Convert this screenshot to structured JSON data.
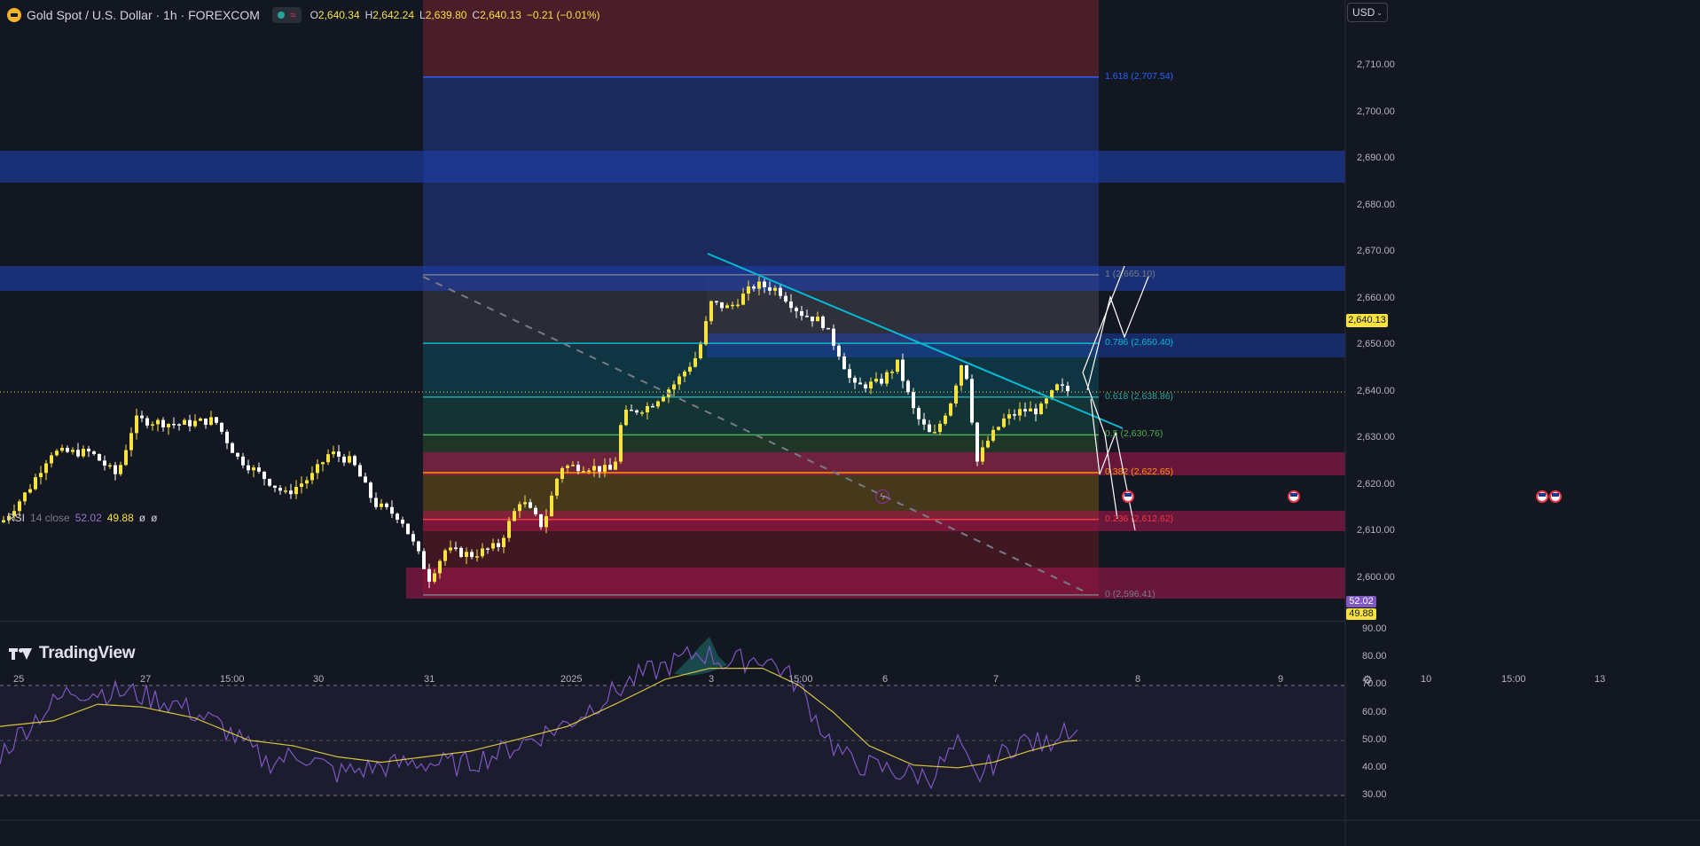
{
  "header": {
    "symbol_title": "Gold Spot / U.S. Dollar · 1h · FOREXCOM",
    "ohlc": {
      "o_label": "O",
      "o_value": "2,640.34",
      "h_label": "H",
      "h_value": "2,642.24",
      "l_label": "L",
      "l_value": "2,639.80",
      "c_label": "C",
      "c_value": "2,640.13",
      "change": "−0.21 (−0.01%)"
    },
    "currency": "USD"
  },
  "price_axis": {
    "labels": [
      "2,710.00",
      "2,700.00",
      "2,690.00",
      "2,680.00",
      "2,670.00",
      "2,660.00",
      "2,650.00",
      "2,640.00",
      "2,630.00",
      "2,620.00",
      "2,610.00",
      "2,600.00"
    ],
    "current_price": "2,640.13"
  },
  "fib_levels": [
    {
      "ratio_text": "1.618 (2,707.54)",
      "price": 2707.54,
      "color": "#2962ff"
    },
    {
      "ratio_text": "1 (2,665.10)",
      "price": 2665.1,
      "color": "#787b86"
    },
    {
      "ratio_text": "0.786 (2,650.40)",
      "price": 2650.4,
      "color": "#00bcd4"
    },
    {
      "ratio_text": "0.618 (2,638.86)",
      "price": 2638.86,
      "color": "#26a69a"
    },
    {
      "ratio_text": "0.5 (2,630.76)",
      "price": 2630.76,
      "color": "#4caf50"
    },
    {
      "ratio_text": "0.382 (2,622.65)",
      "price": 2622.65,
      "color": "#ff9800"
    },
    {
      "ratio_text": "0.236 (2,612.62)",
      "price": 2612.62,
      "color": "#f23645"
    },
    {
      "ratio_text": "0 (2,596.41)",
      "price": 2596.41,
      "color": "#787b86"
    }
  ],
  "rsi": {
    "label": "RSI",
    "params": "14 close",
    "value": "52.02",
    "ma_value": "49.88",
    "na1": "ø",
    "na2": "ø",
    "axis_labels": [
      "90.00",
      "80.00",
      "70.00",
      "60.00",
      "50.00",
      "40.00",
      "30.00"
    ],
    "tag_rsi": "52.02",
    "tag_ma": "49.88"
  },
  "time_axis": {
    "labels": [
      "25",
      "27",
      "15:00",
      "30",
      "31",
      "2025",
      "3",
      "15:00",
      "6",
      "7",
      "8",
      "9",
      "10",
      "15:00",
      "13"
    ]
  },
  "branding": {
    "logo_text": "TradingView"
  },
  "icons": {
    "symbol": "gold-coin-icon",
    "settings": "gear-icon",
    "news": "us-flag-news-icon",
    "flash": "lightning-icon"
  },
  "colors": {
    "background": "#131722",
    "bull_candle": "#f7e23f",
    "bear_candle": "#ffffff",
    "rsi_line": "#7e57c2",
    "rsi_ma": "#f7e23f",
    "trendline": "#00bcd4"
  }
}
